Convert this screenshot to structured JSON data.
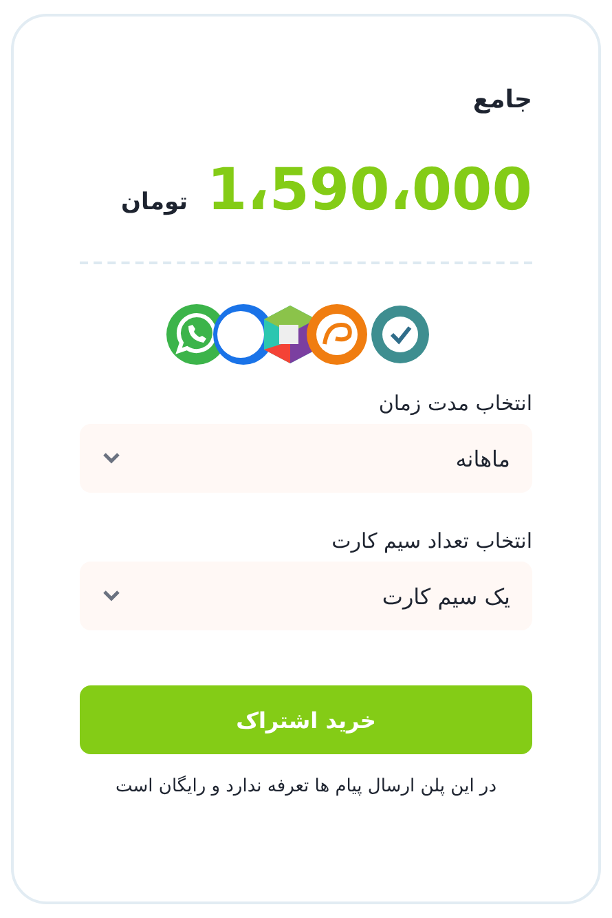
{
  "plan": {
    "title": "جامع",
    "price": "1،590،000",
    "currency": "تومان"
  },
  "selects": [
    {
      "label": "انتخاب مدت زمان",
      "value": "ماهانه"
    },
    {
      "label": "انتخاب تعداد سیم کارت",
      "value": "یک سیم کارت"
    }
  ],
  "button": "خرید اشتراک",
  "note": "در این پلن ارسال پیام ها تعرفه ندارد و رایگان است"
}
